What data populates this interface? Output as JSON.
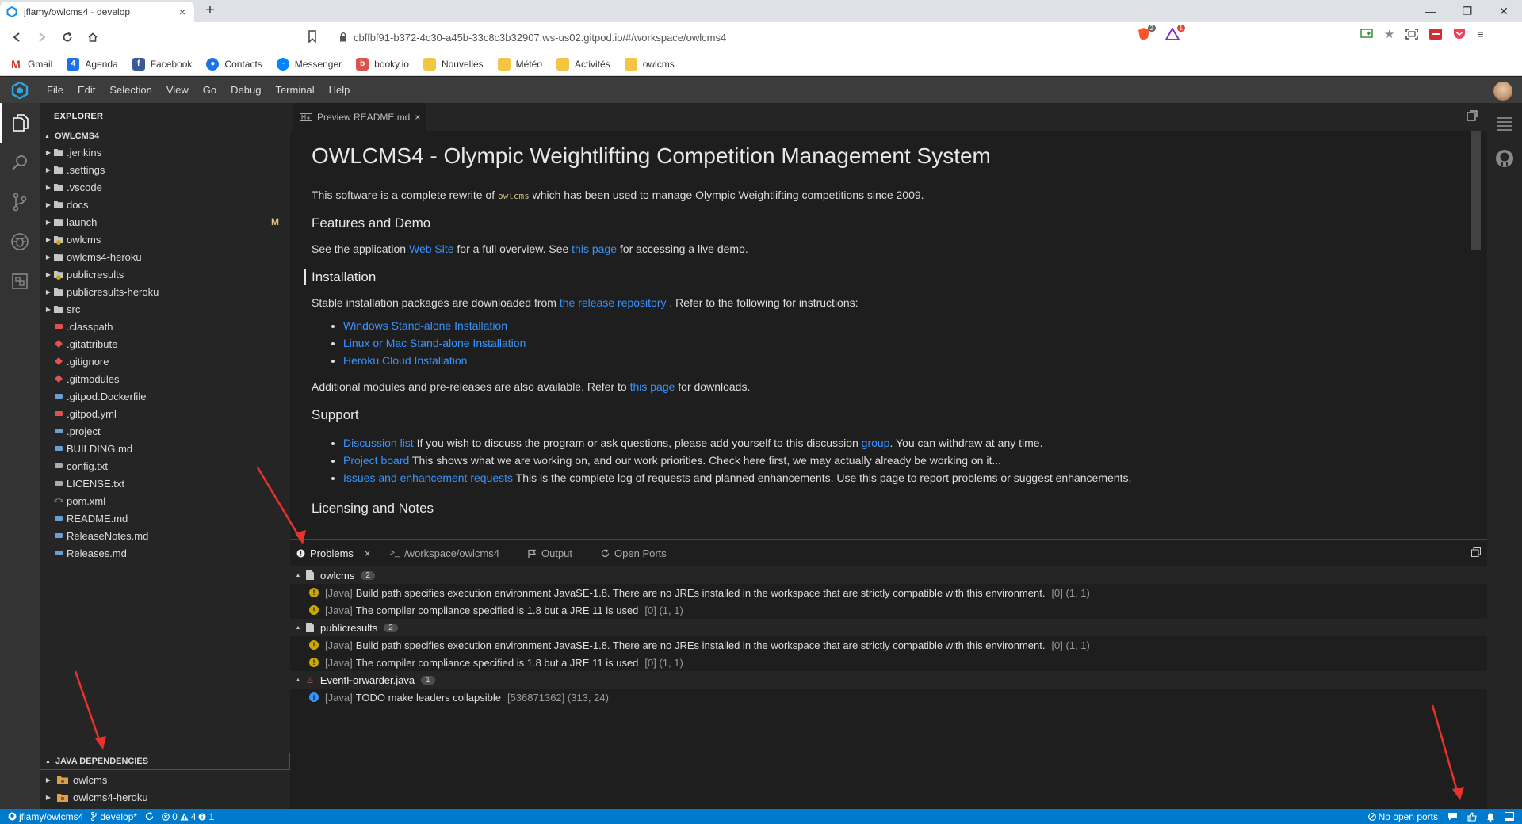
{
  "browser": {
    "tab_title": "jflamy/owlcms4 - develop",
    "url": "cbffbf91-b372-4c30-a45b-33c8c3b32907.ws-us02.gitpod.io/#/workspace/owlcms4",
    "brave_badge": "2",
    "rewards_badge": "1",
    "bookmarks": [
      "Gmail",
      "Agenda",
      "Facebook",
      "Contacts",
      "Messenger",
      "booky.io",
      "Nouvelles",
      "Météo",
      "Activités",
      "owlcms"
    ]
  },
  "menubar": {
    "items": [
      "File",
      "Edit",
      "Selection",
      "View",
      "Go",
      "Debug",
      "Terminal",
      "Help"
    ]
  },
  "sidebar": {
    "title": "EXPLORER",
    "section": "OWLCMS4",
    "folders": [
      ".jenkins",
      ".settings",
      ".vscode",
      "docs",
      "launch",
      "owlcms",
      "owlcms4-heroku",
      "publicresults",
      "publicresults-heroku",
      "src"
    ],
    "launch_badge": "M",
    "files": [
      ".classpath",
      ".gitattribute",
      ".gitignore",
      ".gitmodules",
      ".gitpod.Dockerfile",
      ".gitpod.yml",
      ".project",
      "BUILDING.md",
      "config.txt",
      "LICENSE.txt",
      "pom.xml",
      "README.md",
      "ReleaseNotes.md",
      "Releases.md"
    ],
    "deps_title": "JAVA DEPENDENCIES",
    "deps": [
      "owlcms",
      "owlcms4-heroku"
    ]
  },
  "editor": {
    "tab_label": "Preview README.md",
    "h1": "OWLCMS4 - Olympic Weightlifting Competition Management System",
    "intro_a": "This software is a complete rewrite of ",
    "intro_code": "owlcms",
    "intro_b": " which has been used to manage Olympic Weightlifting competitions since 2009.",
    "h_features": "Features and Demo",
    "feat_a": "See the application ",
    "feat_link1": "Web Site",
    "feat_b": " for a full overview. See ",
    "feat_link2": "this page",
    "feat_c": " for accessing a live demo.",
    "h_install": "Installation",
    "inst_a": "Stable installation packages are downloaded from ",
    "inst_link": "the release repository",
    "inst_b": " . Refer to the following for instructions:",
    "install_links": [
      "Windows Stand-alone Installation",
      "Linux or Mac Stand-alone Installation",
      "Heroku Cloud Installation"
    ],
    "add_a": "Additional modules and pre-releases are also available. Refer to ",
    "add_link": "this page",
    "add_b": " for downloads.",
    "h_support": "Support",
    "sup1_link": "Discussion list",
    "sup1_a": " If you wish to discuss the program or ask questions, please add yourself to this discussion ",
    "sup1_link2": "group",
    "sup1_b": ". You can withdraw at any time.",
    "sup2_link": "Project board",
    "sup2_a": " This shows what we are working on, and our work priorities. Check here first, we may actually already be working on it...",
    "sup3_link": "Issues and enhancement requests",
    "sup3_a": " This is the complete log of requests and planned enhancements. Use this page to report problems or suggest enhancements.",
    "h_licensing": "Licensing and Notes"
  },
  "panel": {
    "tabs": {
      "problems": "Problems",
      "terminal": "/workspace/owlcms4",
      "output": "Output",
      "ports": "Open Ports"
    },
    "groups": [
      {
        "name": "owlcms",
        "count": "2",
        "items": [
          {
            "kind": "warning",
            "src": "[Java]",
            "msg": "Build path specifies execution environment JavaSE-1.8. There are no JREs installed in the workspace that are strictly compatible with this environment.",
            "loc": "[0] (1, 1)"
          },
          {
            "kind": "warning",
            "src": "[Java]",
            "msg": "The compiler compliance specified is 1.8 but a JRE 11 is used",
            "loc": "[0] (1, 1)"
          }
        ]
      },
      {
        "name": "publicresults",
        "count": "2",
        "items": [
          {
            "kind": "warning",
            "src": "[Java]",
            "msg": "Build path specifies execution environment JavaSE-1.8. There are no JREs installed in the workspace that are strictly compatible with this environment.",
            "loc": "[0] (1, 1)"
          },
          {
            "kind": "warning",
            "src": "[Java]",
            "msg": "The compiler compliance specified is 1.8 but a JRE 11 is used",
            "loc": "[0] (1, 1)"
          }
        ]
      },
      {
        "name": "EventForwarder.java",
        "count": "1",
        "items": [
          {
            "kind": "info",
            "src": "[Java]",
            "msg": "TODO make leaders collapsible",
            "loc": "[536871362] (313, 24)"
          }
        ]
      }
    ]
  },
  "statusbar": {
    "repo": "jflamy/owlcms4",
    "branch": "develop*",
    "errors": "0",
    "warnings": "4",
    "infos": "1",
    "ports": "No open ports"
  },
  "colors": {
    "statusbar": "#007acc",
    "link": "#3794ff",
    "warning": "#cca700",
    "arrow": "#e8322b"
  }
}
